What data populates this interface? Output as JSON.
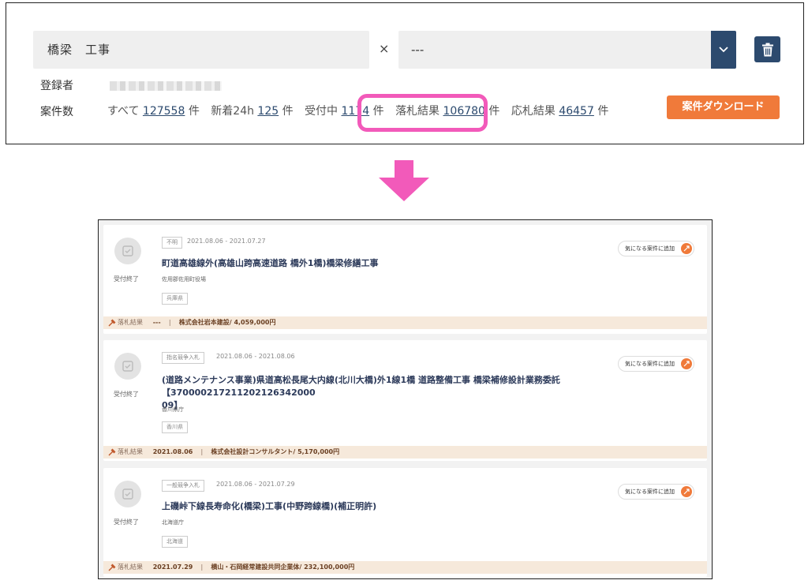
{
  "search": {
    "keyword": "橋梁　工事",
    "clear_symbol": "×",
    "select_value": "---"
  },
  "registrant": {
    "label": "登録者"
  },
  "counts": {
    "label": "案件数",
    "all_label": "すべて",
    "all_value": "127558",
    "new_label": "新着24h",
    "new_value": "125",
    "open_label": "受付中",
    "open_value": "1174",
    "award_label": "落札結果",
    "award_value": "106780",
    "order_label": "応札結果",
    "order_value": "46457",
    "unit": "件"
  },
  "download_button": "案件ダウンロード",
  "colors": {
    "navy": "#2c4a6e",
    "orange": "#f07a3a",
    "highlight_pink": "#f25aba",
    "result_bar": "#f6e9db"
  },
  "cards": [
    {
      "status": "受付終了",
      "tag": "不明",
      "date_range": "2021.08.06 - 2021.07.27",
      "favorite_label": "気になる案件に追加",
      "title": "町道高雄線外(高雄山跨高速道路 橋外1橋)橋梁修繕工事",
      "org": "佐用郡佐用町役場",
      "prefecture": "兵庫県",
      "result_label": "落札結果",
      "result_date": "---",
      "separator": "|",
      "winner": "株式会社岩本建設/ 4,059,000円"
    },
    {
      "status": "受付終了",
      "tag": "指名競争入札",
      "date_range": "2021.08.06 - 2021.08.06",
      "favorite_label": "気になる案件に追加",
      "title_line1": "(道路メンテナンス事業)県道高松長尾大内線(北川大橋)外1線1橋 道路整備工事 橋梁補修設計業務委託【370000217211202126342000",
      "title_line2": "09】",
      "org": "香川県庁",
      "prefecture": "香川県",
      "result_label": "落札結果",
      "result_date": "2021.08.06",
      "separator": "|",
      "winner": "株式会社設計コンサルタント/ 5,170,000円"
    },
    {
      "status": "受付終了",
      "tag": "一般競争入札",
      "date_range": "2021.08.06 - 2021.07.29",
      "favorite_label": "気になる案件に追加",
      "title": "上磯峠下線長寿命化(橋梁)工事(中野跨線橋)(補正明許)",
      "org": "北海道庁",
      "prefecture": "北海道",
      "result_label": "落札結果",
      "result_date": "2021.07.29",
      "separator": "|",
      "winner": "横山・石岡経常建設共同企業体/ 232,100,000円"
    }
  ]
}
